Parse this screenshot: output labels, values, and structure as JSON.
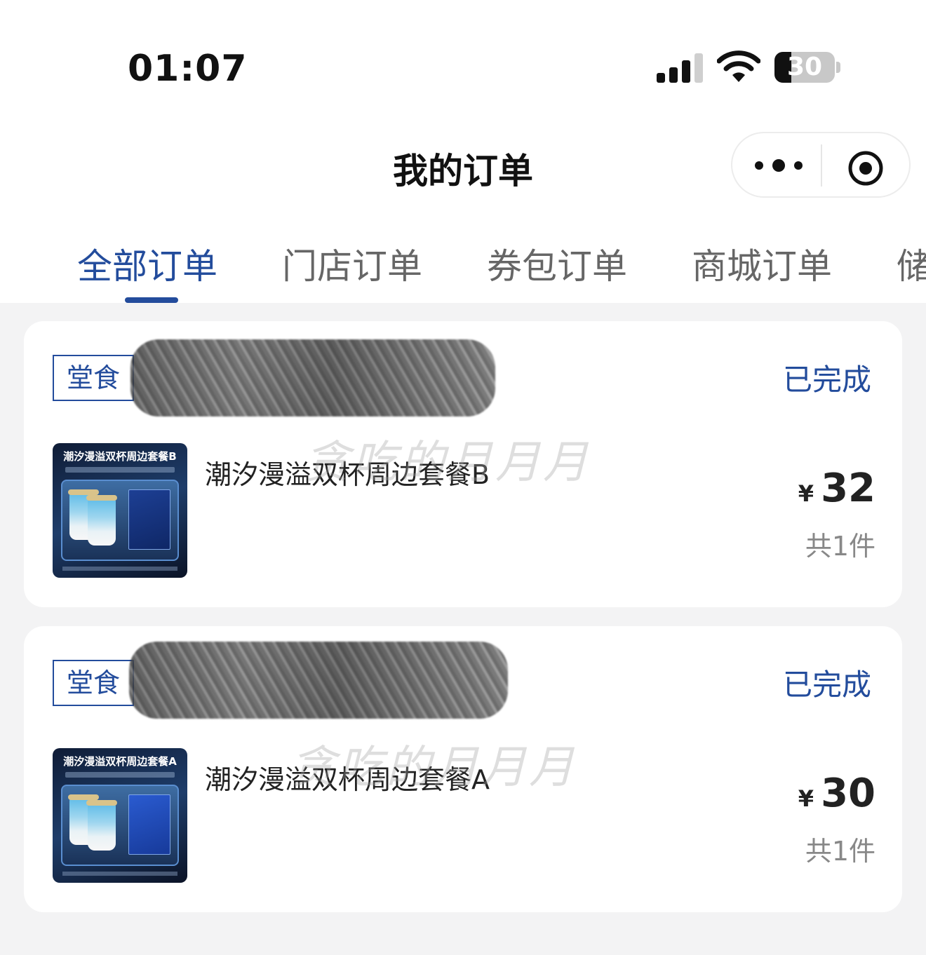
{
  "status_bar": {
    "time": "01:07",
    "battery": "30"
  },
  "nav": {
    "title": "我的订单",
    "more_icon": "more-dots-icon",
    "target_icon": "target-icon"
  },
  "tabs": [
    {
      "label": "全部订单",
      "active": true
    },
    {
      "label": "门店订单",
      "active": false
    },
    {
      "label": "券包订单",
      "active": false
    },
    {
      "label": "商城订单",
      "active": false
    },
    {
      "label": "储",
      "active": false
    }
  ],
  "orders": [
    {
      "badge": "堂食",
      "status": "已完成",
      "thumb_title": "潮汐漫溢双杯周边套餐B",
      "item_name": "潮汐漫溢双杯周边套餐B",
      "currency": "¥",
      "price": "32",
      "count": "共1件",
      "watermark": "贪吃的月月月"
    },
    {
      "badge": "堂食",
      "status": "已完成",
      "thumb_title": "潮汐漫溢双杯周边套餐A",
      "item_name": "潮汐漫溢双杯周边套餐A",
      "currency": "¥",
      "price": "30",
      "count": "共1件",
      "watermark": "贪吃的月月月"
    }
  ],
  "colors": {
    "accent": "#234c9c",
    "background": "#f3f3f4",
    "card": "#ffffff"
  }
}
